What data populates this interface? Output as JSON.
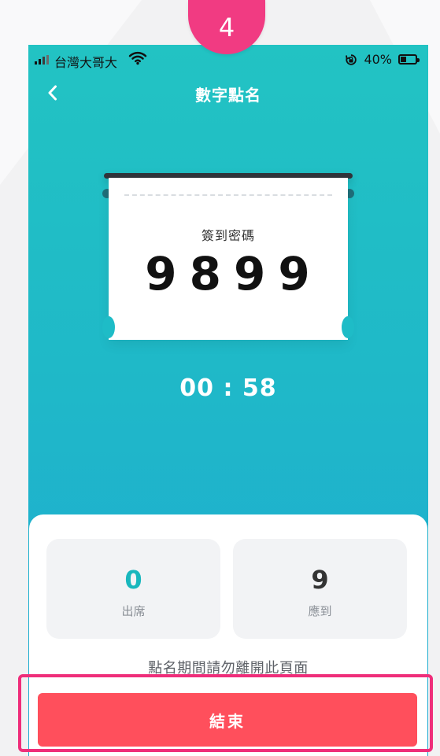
{
  "step": "4",
  "status_bar": {
    "carrier": "台灣大哥大",
    "battery_text": "40%",
    "battery_level": 0.4
  },
  "nav": {
    "title": "數字點名"
  },
  "checkin": {
    "label": "簽到密碼",
    "code": "9899",
    "countdown": "00 : 58"
  },
  "stats": {
    "present_count": "0",
    "present_label": "出席",
    "expected_count": "9",
    "expected_label": "應到"
  },
  "notice": "點名期間請勿離開此頁面",
  "action": {
    "end_label": "結束"
  },
  "colors": {
    "teal": "#1fb9c8",
    "highlight": "#ef2e7a",
    "end_button": "#ff4f5c"
  },
  "icons": {
    "back": "chevron-left-icon",
    "wifi": "wifi-icon",
    "rotation_lock": "rotation-lock-icon",
    "battery": "battery-icon",
    "signal": "signal-icon"
  }
}
